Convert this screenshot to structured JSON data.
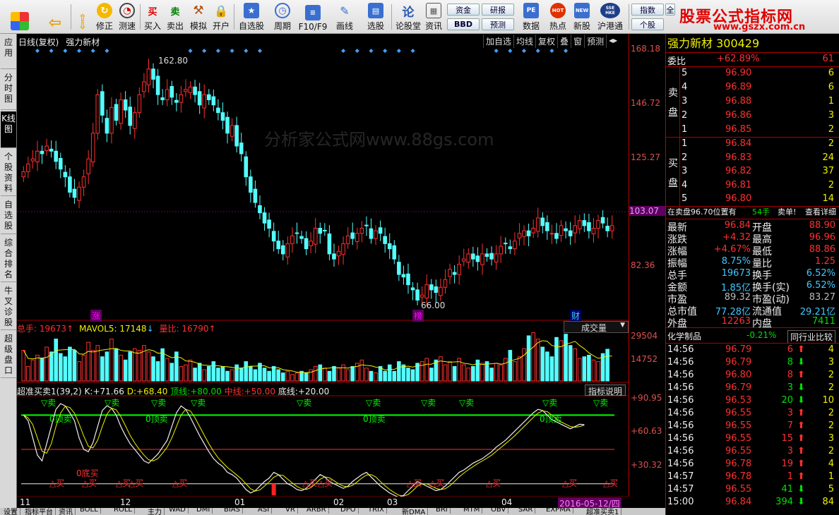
{
  "toolbar": {
    "buttons": [
      {
        "label": "修正"
      },
      {
        "label": "测速"
      },
      {
        "label": "买入"
      },
      {
        "label": "卖出"
      },
      {
        "label": "模拟"
      },
      {
        "label": "开户"
      },
      {
        "label": "自选股"
      },
      {
        "label": "周期"
      },
      {
        "label": "F10/F9"
      },
      {
        "label": "画线"
      },
      {
        "label": "选股"
      },
      {
        "label": "论股堂"
      },
      {
        "label": "资讯"
      },
      {
        "label": "数据"
      },
      {
        "label": "热点"
      },
      {
        "label": "新股"
      },
      {
        "label": "沪港通"
      }
    ],
    "small_buttons": [
      "资金",
      "研报",
      "BBD",
      "预测",
      "指数",
      "个股",
      "全"
    ],
    "icon_texts": {
      "buy": "买",
      "sell": "卖",
      "luntan": "论",
      "pe": "PE",
      "hot": "HOT",
      "new": "NEW",
      "hk": "SSE HKE"
    }
  },
  "logo": {
    "title": "股票公式指标网",
    "url": "www.gszx.com.cn"
  },
  "left_tabs": [
    {
      "label": "应用"
    },
    {
      "label": "分时图"
    },
    {
      "label": "K线图"
    },
    {
      "label": "个股资料"
    },
    {
      "label": "自选股"
    },
    {
      "label": "综合排名"
    },
    {
      "label": "牛叉诊股"
    },
    {
      "label": "超级盘口"
    }
  ],
  "chart": {
    "header_left": "日线(复权)",
    "stock_name": "强力新材",
    "mini_toolbar": [
      "加自选",
      "均线",
      "复权",
      "叠",
      "窗",
      "预测"
    ],
    "watermark": "分析家公式网www.88gs.com",
    "high_label": "162.80",
    "low_label": "66.00",
    "events": [
      "涨",
      "榜",
      "财"
    ],
    "current_price_tag": "103.07",
    "price_axis": [
      "168.18",
      "146.72",
      "125.27",
      "82.36"
    ],
    "volume_header": {
      "total_label": "总手:",
      "total": "19673",
      "mavol_label": "MAVOL5:",
      "mavol": "17148",
      "ratio_label": "量比:",
      "ratio": "16790"
    },
    "volume_dropdown": "成交量",
    "volume_axis": [
      "29504",
      "14752"
    ],
    "indicator_header": {
      "name": "超准买卖1(39,2)",
      "k_label": "K:",
      "k": "+71.66",
      "d_label": "D:",
      "d": "+68.40",
      "top_label": "顶线:",
      "top": "+80.00",
      "mid_label": "中线:",
      "mid": "+50.00",
      "bottom_label": "底线:",
      "bottom": "+20.00"
    },
    "indicator_button": "指标说明",
    "indicator_axis": [
      "+90.95",
      "+60.63",
      "+30.32"
    ],
    "sell_label": "▽卖",
    "buy_label": "△买",
    "top_label": "0顶卖",
    "bottom_label": "0底买",
    "x_labels": [
      "11",
      "12",
      "01",
      "02",
      "03",
      "04"
    ],
    "date_tag": "2016-05-12/四"
  },
  "chart_data": {
    "type": "candlestick",
    "title": "强力新材",
    "ylim": [
      66.0,
      168.18
    ],
    "close": [
      120,
      123,
      125,
      128,
      127,
      130,
      128,
      124,
      121,
      118,
      112,
      110,
      114,
      118,
      125,
      135,
      150,
      142,
      135,
      145,
      140,
      148,
      144,
      138,
      143,
      150,
      155,
      160,
      156,
      150,
      148,
      152,
      149,
      147,
      150,
      152,
      153,
      150,
      146,
      150,
      148,
      146,
      143,
      140,
      135,
      138,
      130,
      127,
      118,
      112,
      108,
      104,
      100,
      98,
      93,
      90,
      88,
      92,
      95,
      96,
      94,
      90,
      93,
      98,
      96,
      97,
      88,
      86,
      89,
      92,
      95,
      94,
      96,
      98,
      99,
      94,
      97,
      96,
      92,
      90,
      86,
      80,
      79,
      76,
      74,
      70,
      72,
      76,
      74,
      73,
      75,
      78,
      82,
      80,
      84,
      86,
      88,
      86,
      85,
      88,
      87,
      86,
      88,
      91,
      92,
      90,
      93,
      96,
      97,
      95,
      98,
      102,
      99,
      97,
      96,
      94,
      99,
      97,
      95,
      99,
      101,
      99,
      97,
      98,
      101,
      100,
      97,
      99
    ],
    "volume": [
      19000,
      9000,
      13000,
      16000,
      14000,
      21000,
      18000,
      26000,
      17000,
      15000,
      21000,
      19000,
      12000,
      16000,
      24000,
      19000,
      22000,
      15000,
      18000,
      26000,
      20000,
      16000,
      13000,
      18000,
      20000,
      19000,
      22000,
      18000,
      15000,
      12000,
      20000,
      14000,
      11000,
      18000,
      9000,
      10000,
      13000,
      8000,
      11000,
      7000,
      9000,
      12000,
      8000,
      9000,
      6000,
      7000,
      10000,
      8000,
      12000,
      9000,
      7000,
      11000,
      8000,
      6000,
      9000,
      7000,
      5000,
      6000,
      4000,
      5000,
      6000,
      5000,
      7000,
      9000,
      10000,
      8000,
      6000,
      9000,
      8000,
      10000,
      7000,
      9000,
      11000,
      13000,
      8000,
      6000,
      5000,
      9000,
      6000,
      10000,
      6000,
      12000,
      10000,
      8000,
      7000,
      11000,
      12000,
      14000,
      8000,
      13000,
      15000,
      10000,
      12000,
      9000,
      14000,
      10000,
      8000,
      9000,
      13000,
      11000,
      12000,
      8000,
      11000,
      10000,
      14000,
      19000,
      12000,
      15000,
      20000,
      28000,
      30000,
      26000,
      21000,
      18000,
      15000,
      27000,
      25000,
      29000,
      22000,
      20000,
      14000,
      15000,
      16000,
      13000,
      12000,
      17000,
      19673
    ],
    "k_line": [
      80,
      75,
      60,
      45,
      40,
      55,
      70,
      85,
      90,
      88,
      82,
      75,
      60,
      50,
      48,
      56,
      70,
      84,
      88,
      86,
      80,
      70,
      62,
      55,
      50,
      45,
      40,
      38,
      42,
      46,
      52,
      58,
      70,
      82,
      88,
      85,
      78,
      70,
      62,
      55,
      48,
      42,
      38,
      35,
      30,
      28,
      25,
      20,
      15,
      12,
      14,
      18,
      22,
      25,
      30,
      28,
      24,
      20,
      18,
      15,
      14,
      16,
      20,
      24,
      28,
      26,
      22,
      20,
      18,
      16,
      18,
      22,
      25,
      28,
      30,
      26,
      22,
      18,
      15,
      12,
      10,
      8,
      10,
      14,
      18,
      22,
      20,
      18,
      16,
      14,
      15,
      18,
      22,
      26,
      30,
      32,
      35,
      38,
      40,
      42,
      45,
      48,
      52,
      55,
      58,
      62,
      66,
      70,
      74,
      78,
      82,
      85,
      84,
      80,
      76,
      74,
      72,
      70,
      68,
      70,
      72,
      71.66
    ]
  },
  "right_panel": {
    "stock_title": "强力新材 300429",
    "weibi_label": "委比",
    "weibi": "+62.89%",
    "weibi_diff": "61",
    "sell_side_label": "卖盘",
    "buy_side_label": "买盘",
    "asks": [
      {
        "level": "5",
        "price": "96.90",
        "vol": "6"
      },
      {
        "level": "4",
        "price": "96.89",
        "vol": "6"
      },
      {
        "level": "3",
        "price": "96.88",
        "vol": "1"
      },
      {
        "level": "2",
        "price": "96.86",
        "vol": "3"
      },
      {
        "level": "1",
        "price": "96.85",
        "vol": "2"
      }
    ],
    "bids": [
      {
        "level": "1",
        "price": "96.84",
        "vol": "2"
      },
      {
        "level": "2",
        "price": "96.83",
        "vol": "24"
      },
      {
        "level": "3",
        "price": "96.82",
        "vol": "37"
      },
      {
        "level": "4",
        "price": "96.81",
        "vol": "2"
      },
      {
        "level": "5",
        "price": "96.80",
        "vol": "14"
      }
    ],
    "notice": {
      "left": "在卖盘96.70位置有",
      "vol": "54手",
      "right": "卖单!",
      "link": "查看详细"
    },
    "stats": [
      {
        "l1": "最新",
        "v1": "96.84",
        "c1": "red",
        "l2": "开盘",
        "v2": "88.90",
        "c2": "red"
      },
      {
        "l1": "涨跌",
        "v1": "+4.32",
        "c1": "red",
        "l2": "最高",
        "v2": "96.96",
        "c2": "red"
      },
      {
        "l1": "涨幅",
        "v1": "+4.67%",
        "c1": "red",
        "l2": "最低",
        "v2": "88.86",
        "c2": "red"
      },
      {
        "l1": "振幅",
        "v1": "8.75%",
        "c1": "cyan",
        "l2": "量比",
        "v2": "1.25",
        "c2": "red"
      },
      {
        "l1": "总手",
        "v1": "19673",
        "c1": "cyan",
        "l2": "换手",
        "v2": "6.52%",
        "c2": "cyan"
      },
      {
        "l1": "金额",
        "v1": "1.85亿",
        "c1": "cyan",
        "l2": "换手(实)",
        "v2": "6.52%",
        "c2": "cyan"
      },
      {
        "l1": "市盈",
        "v1": "89.32",
        "c1": "gray",
        "l2": "市盈(动)",
        "v2": "83.27",
        "c2": "gray"
      },
      {
        "l1": "总市值",
        "v1": "77.28亿",
        "c1": "cyan",
        "l2": "流通值",
        "v2": "29.21亿",
        "c2": "cyan"
      },
      {
        "l1": "外盘",
        "v1": "12263",
        "c1": "red",
        "l2": "内盘",
        "v2": "7411",
        "c2": "green"
      }
    ],
    "industry": {
      "name": "化学制品",
      "change": "-0.21%",
      "button": "同行业比较"
    },
    "ticks": [
      {
        "time": "14:56",
        "price": "96.79",
        "vol": "6",
        "dir": "up",
        "n": "4"
      },
      {
        "time": "14:56",
        "price": "96.79",
        "vol": "8",
        "dir": "down",
        "n": "3"
      },
      {
        "time": "14:56",
        "price": "96.80",
        "vol": "8",
        "dir": "up",
        "n": "2"
      },
      {
        "time": "14:56",
        "price": "96.79",
        "vol": "3",
        "dir": "down",
        "n": "2"
      },
      {
        "time": "14:56",
        "price": "96.53",
        "vol": "20",
        "dir": "down",
        "n": "10"
      },
      {
        "time": "14:56",
        "price": "96.55",
        "vol": "3",
        "dir": "up",
        "n": "2"
      },
      {
        "time": "14:56",
        "price": "96.55",
        "vol": "7",
        "dir": "up",
        "n": "2"
      },
      {
        "time": "14:56",
        "price": "96.55",
        "vol": "15",
        "dir": "up",
        "n": "3"
      },
      {
        "time": "14:56",
        "price": "96.55",
        "vol": "3",
        "dir": "up",
        "n": "2"
      },
      {
        "time": "14:56",
        "price": "96.78",
        "vol": "19",
        "dir": "up",
        "n": "4"
      },
      {
        "time": "14:57",
        "price": "96.78",
        "vol": "1",
        "dir": "up",
        "n": "1"
      },
      {
        "time": "14:57",
        "price": "96.55",
        "vol": "41",
        "dir": "down",
        "n": "5"
      },
      {
        "time": "15:00",
        "price": "96.84",
        "vol": "394",
        "dir": "down",
        "n": "84"
      }
    ]
  },
  "bottom_tabs": [
    "设置",
    "指标平台",
    "资讯",
    "BOLL",
    "ROLL",
    "主力",
    "WAD",
    "DMI",
    "BIAS",
    "ASI",
    "VR",
    "ARBR",
    "DPO",
    "TRIX",
    "新DMA",
    "BRI",
    "MTM",
    "OBV",
    "SAR",
    "EXPMA",
    "超准买卖1"
  ],
  "colors": {
    "up": "#ff3030",
    "down": "#54ffff",
    "ma": "#f0f000",
    "sell_line": "#00ff00",
    "accent": "#e00000"
  }
}
